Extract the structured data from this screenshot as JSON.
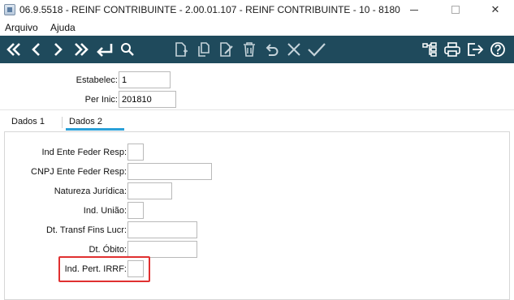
{
  "window": {
    "title": "06.9.5518 - REINF CONTRIBUINTE - 2.00.01.107 - REINF CONTRIBUINTE - 10 - 8180",
    "minimize_glyph": "",
    "close_glyph": "✕"
  },
  "menu": {
    "items": [
      "Arquivo",
      "Ajuda"
    ]
  },
  "toolbar": {
    "color": "#1f4a5c",
    "nav_icons": [
      "first-record-icon",
      "previous-record-icon",
      "next-record-icon",
      "last-record-icon",
      "return-icon",
      "search-icon"
    ],
    "edit_icons": [
      "new-document-icon",
      "copy-document-icon",
      "edit-document-icon",
      "delete-icon",
      "undo-icon",
      "cancel-icon",
      "confirm-icon"
    ],
    "right_icons": [
      "tree-structure-icon",
      "print-icon",
      "exit-icon",
      "help-icon"
    ]
  },
  "header": {
    "estabelec": {
      "label": "Estabelec:",
      "value": "1"
    },
    "per_inic": {
      "label": "Per Inic:",
      "value": "201810"
    }
  },
  "tabs": {
    "items": [
      "Dados 1",
      "Dados 2"
    ],
    "active": "Dados 2",
    "accent": "#2aa0d8"
  },
  "form": {
    "ind_ente_feder_resp": {
      "label": "Ind Ente Feder Resp:",
      "value": ""
    },
    "cnpj_ente_feder_resp": {
      "label": "CNPJ Ente Feder Resp:",
      "value": ""
    },
    "natureza_juridica": {
      "label": "Natureza Jurídica:",
      "value": ""
    },
    "ind_uniao": {
      "label": "Ind. União:",
      "value": ""
    },
    "dt_transf_fins_lucr": {
      "label": "Dt. Transf Fins Lucr:",
      "value": ""
    },
    "dt_obito": {
      "label": "Dt. Óbito:",
      "value": ""
    },
    "ind_pert_irrf": {
      "label": "Ind. Pert. IRRF:",
      "value": ""
    }
  },
  "highlight_color": "#e03030"
}
